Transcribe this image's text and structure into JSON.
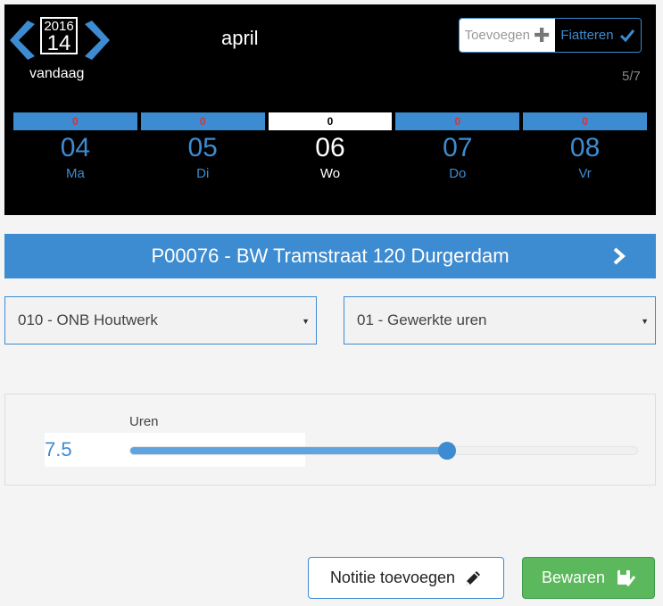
{
  "header": {
    "prev_icon": "chevron-left-icon",
    "next_icon": "chevron-right-icon",
    "calendar": {
      "year": "2016",
      "day": "14"
    },
    "today_label": "vandaag",
    "month": "april",
    "page_count": "5/7",
    "add_button": {
      "label": "Toevoegen",
      "icon": "plus-icon"
    },
    "approve_button": {
      "label": "Fiatteren",
      "icon": "check-icon"
    }
  },
  "week": {
    "days": [
      {
        "count": "0",
        "number": "04",
        "name": "Ma",
        "active": false
      },
      {
        "count": "0",
        "number": "05",
        "name": "Di",
        "active": false
      },
      {
        "count": "0",
        "number": "06",
        "name": "Wo",
        "active": true
      },
      {
        "count": "0",
        "number": "07",
        "name": "Do",
        "active": false
      },
      {
        "count": "0",
        "number": "08",
        "name": "Vr",
        "active": false
      }
    ]
  },
  "project": {
    "title": "P00076 - BW Tramstraat 120 Durgerdam",
    "icon": "chevron-right-icon"
  },
  "selects": {
    "activity": "010 - ONB Houtwerk",
    "hour_type": "01 - Gewerkte uren"
  },
  "hours": {
    "label": "Uren",
    "value": "7.5",
    "slider_fraction": 0.625
  },
  "actions": {
    "note_label": "Notitie toevoegen",
    "note_icon": "pencil-icon",
    "save_label": "Bewaren",
    "save_icon": "save-check-icon"
  },
  "colors": {
    "accent": "#3d8bd0",
    "save": "#5cb85c",
    "count": "#dd3333"
  }
}
